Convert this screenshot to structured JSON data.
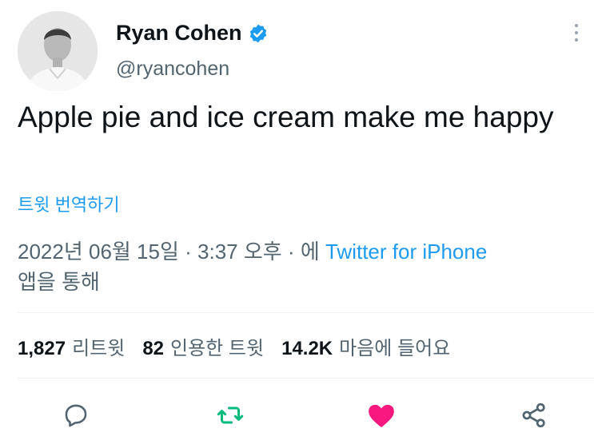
{
  "author": {
    "name": "Ryan Cohen",
    "handle": "@ryancohen"
  },
  "tweet": {
    "text": "Apple pie and ice cream make me happy",
    "translate_label": "트윗 번역하기"
  },
  "meta": {
    "date": "2022년 06월 15일",
    "time": "3:37 오후",
    "source_prefix": "에",
    "source": "Twitter for iPhone",
    "source_suffix": "앱을 통해"
  },
  "stats": {
    "retweets": "1,827",
    "retweets_label": "리트윗",
    "quotes": "82",
    "quotes_label": "인용한 트윗",
    "likes": "14.2K",
    "likes_label": "마음에 들어요"
  },
  "actions": [
    {
      "icon": "reply-icon",
      "color": "#1d9bf0"
    },
    {
      "icon": "retweet-icon",
      "color": "#00ba7c"
    },
    {
      "icon": "heart-filled-icon",
      "color": "#f91880"
    },
    {
      "icon": "share-icon",
      "color": "#536471"
    }
  ],
  "colors": {
    "accent": "#1d9bf0",
    "secondary_text": "#536471",
    "like": "#f91880",
    "retweet": "#00ba7c"
  }
}
